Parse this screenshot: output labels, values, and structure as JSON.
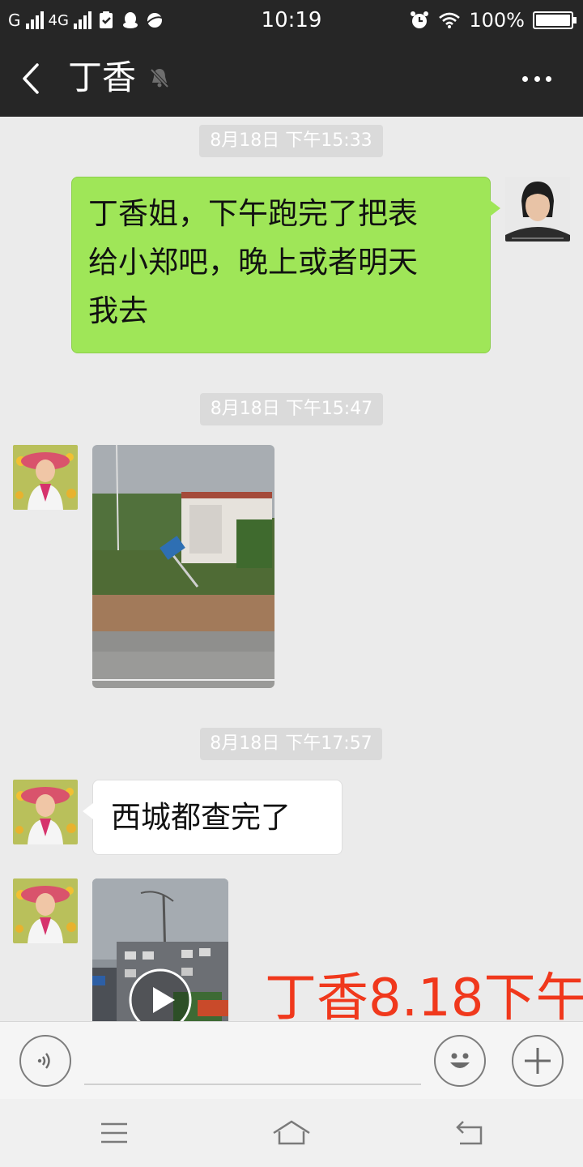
{
  "status_bar": {
    "network_g": "G",
    "network_4g": "4G",
    "time": "10:19",
    "battery_text": "100%",
    "battery_level": 1.0
  },
  "header": {
    "title": "丁香"
  },
  "messages": [
    {
      "type": "timestamp",
      "text": "8月18日 下午15:33"
    },
    {
      "type": "text",
      "direction": "sent",
      "lines": [
        "丁香姐，下午跑完了把表",
        "给小郑吧，晚上或者明天",
        "我去"
      ]
    },
    {
      "type": "timestamp",
      "text": "8月18日 下午15:47"
    },
    {
      "type": "image",
      "direction": "received"
    },
    {
      "type": "timestamp",
      "text": "8月18日 下午17:57"
    },
    {
      "type": "text",
      "direction": "received",
      "text": "西城都查完了"
    },
    {
      "type": "video",
      "direction": "received"
    }
  ],
  "watermark": "丁香8.18下午",
  "input_bar": {
    "placeholder": ""
  },
  "colors": {
    "header_bg": "#262626",
    "chat_bg": "#ebebeb",
    "sent_bubble": "#9fe658",
    "received_bubble": "#ffffff",
    "timestamp_bg": "#dadada",
    "watermark": "#f0381c"
  },
  "icons": [
    "signal-icon",
    "checklist-icon",
    "qq-icon",
    "planet-icon",
    "alarm-icon",
    "wifi-icon",
    "battery-icon",
    "back-icon",
    "mute-bell-icon",
    "more-icon",
    "voice-icon",
    "emoji-icon",
    "plus-icon",
    "play-icon",
    "menu-icon",
    "home-icon",
    "return-icon"
  ]
}
